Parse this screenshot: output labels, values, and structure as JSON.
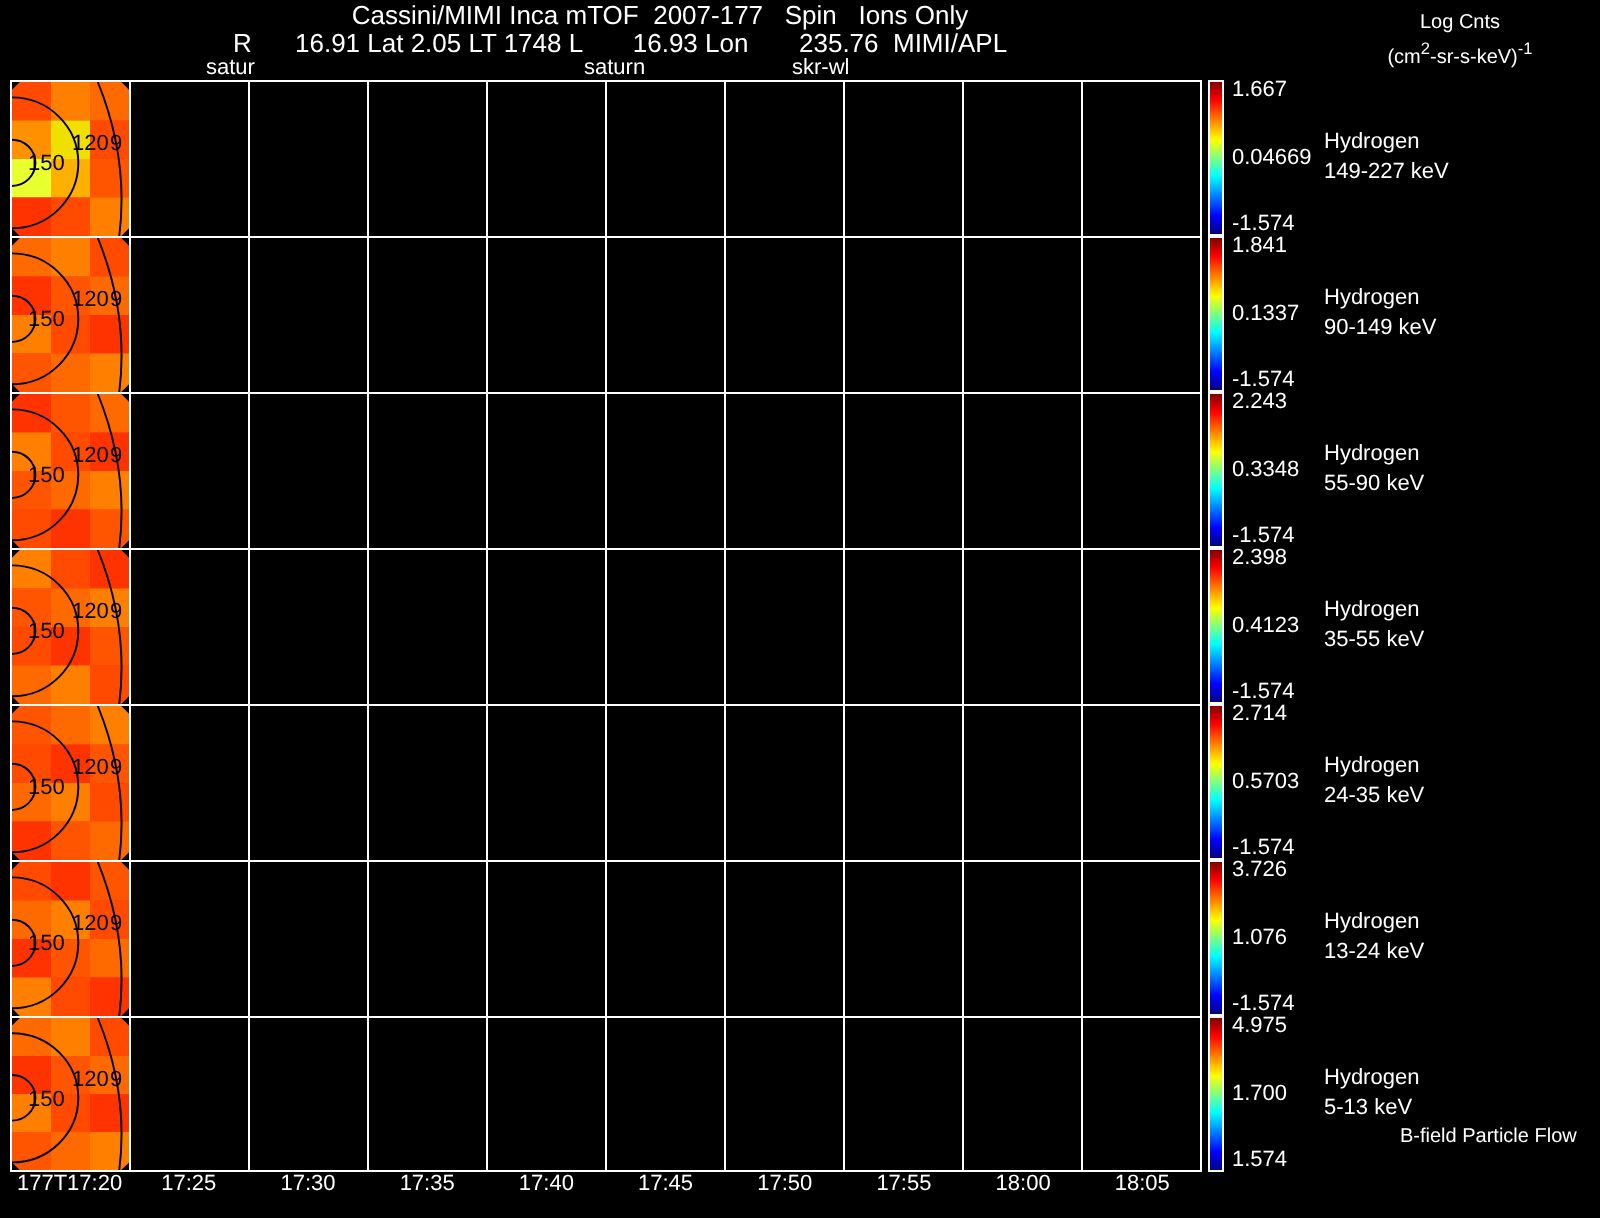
{
  "title": "Cassini/MIMI Inca mTOF  2007-177   Spin   Ions Only",
  "ephemeris": "R      16.91 Lat 2.05 LT 1748 L       16.93 Lon       235.76  MIMI/APL",
  "units": {
    "label": "Log Cnts",
    "unit": "(cm$^{2}$-sr-s-keV)$^{-1}$"
  },
  "markers": [
    "satur",
    "saturn",
    "skr-wl"
  ],
  "panels": [
    {
      "species": "Hydrogen",
      "energy": "149-227 keV",
      "cbar_max": "1.667",
      "cbar_mid": "0.04669",
      "cbar_min": "-1.574",
      "contour_labels": [
        "150",
        "120",
        "9"
      ]
    },
    {
      "species": "Hydrogen",
      "energy": "90-149 keV",
      "cbar_max": "1.841",
      "cbar_mid": "0.1337",
      "cbar_min": "-1.574",
      "contour_labels": [
        "150",
        "120",
        "9"
      ]
    },
    {
      "species": "Hydrogen",
      "energy": "55-90 keV",
      "cbar_max": "2.243",
      "cbar_mid": "0.3348",
      "cbar_min": "-1.574",
      "contour_labels": [
        "150",
        "120",
        "9"
      ]
    },
    {
      "species": "Hydrogen",
      "energy": "35-55 keV",
      "cbar_max": "2.398",
      "cbar_mid": "0.4123",
      "cbar_min": "-1.574",
      "contour_labels": [
        "150",
        "120",
        "9"
      ]
    },
    {
      "species": "Hydrogen",
      "energy": "24-35 keV",
      "cbar_max": "2.714",
      "cbar_mid": "0.5703",
      "cbar_min": "-1.574",
      "contour_labels": [
        "150",
        "120",
        "9"
      ]
    },
    {
      "species": "Hydrogen",
      "energy": "13-24 keV",
      "cbar_max": "3.726",
      "cbar_mid": "1.076",
      "cbar_min": "-1.574",
      "contour_labels": [
        "150",
        "120",
        "9"
      ]
    },
    {
      "species": "Hydrogen",
      "energy": "5-13 keV",
      "cbar_max": "4.975",
      "cbar_mid": "1.700",
      "cbar_min": "1.574",
      "contour_labels": [
        "150",
        "120",
        "9"
      ],
      "note": "B-field Particle Flow"
    }
  ],
  "time_axis": [
    "177T17:20",
    "17:25",
    "17:30",
    "17:35",
    "17:40",
    "17:45",
    "17:50",
    "17:55",
    "18:00",
    "18:05"
  ]
}
